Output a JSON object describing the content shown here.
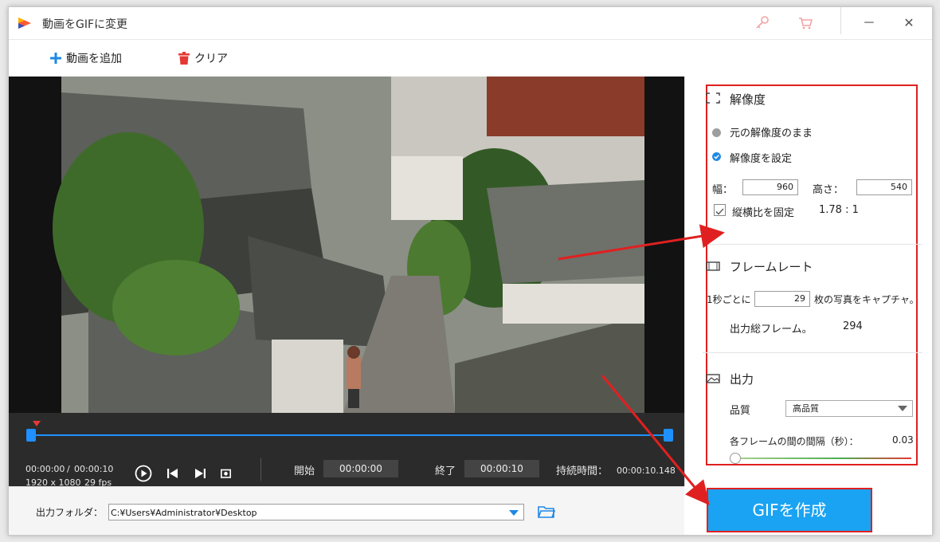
{
  "window": {
    "title": "動画をGIFに変更",
    "key_icon": "key-icon",
    "cart_icon": "cart-icon",
    "minimize_label": "－",
    "close_label": "✕"
  },
  "toolbar": {
    "add_video_label": "動画を追加",
    "clear_label": "クリア"
  },
  "player": {
    "current_time": "00:00:00",
    "separator": "/",
    "total_time": "00:00:10",
    "resolution": "1920 x 1080",
    "fps": "29 fps",
    "start_label": "開始",
    "start_value": "00:00:00",
    "end_label": "終了",
    "end_value": "00:00:10",
    "duration_label": "持続時間：",
    "duration_value": "00:00:10.148"
  },
  "output": {
    "folder_label": "出力フォルダ：",
    "folder_path": "C:¥Users¥Administrator¥Desktop"
  },
  "settings": {
    "resolution_header": "解像度",
    "keep_original_label": "元の解像度のまま",
    "set_resolution_label": "解像度を設定",
    "width_label": "幅：",
    "width_value": "960",
    "height_label": "高さ：",
    "height_value": "540",
    "lock_ratio_label": "縦横比を固定",
    "ratio_value": "1.78 : 1",
    "framerate_header": "フレームレート",
    "per_second_label": "1秒ごとに",
    "fps_value": "29",
    "capture_label": "枚の写真をキャプチャ。",
    "total_frames_label": "出力総フレーム。",
    "total_frames_value": "294",
    "output_header": "出力",
    "quality_label": "品質",
    "quality_value": "高品質",
    "interval_label": "各フレームの間の間隔（秒）：",
    "interval_value": "0.03"
  },
  "make_gif_label": "GIFを作成",
  "colors": {
    "accent": "#1aa3f2",
    "highlight": "#e02020",
    "control_bar": "#2b2b2b"
  }
}
